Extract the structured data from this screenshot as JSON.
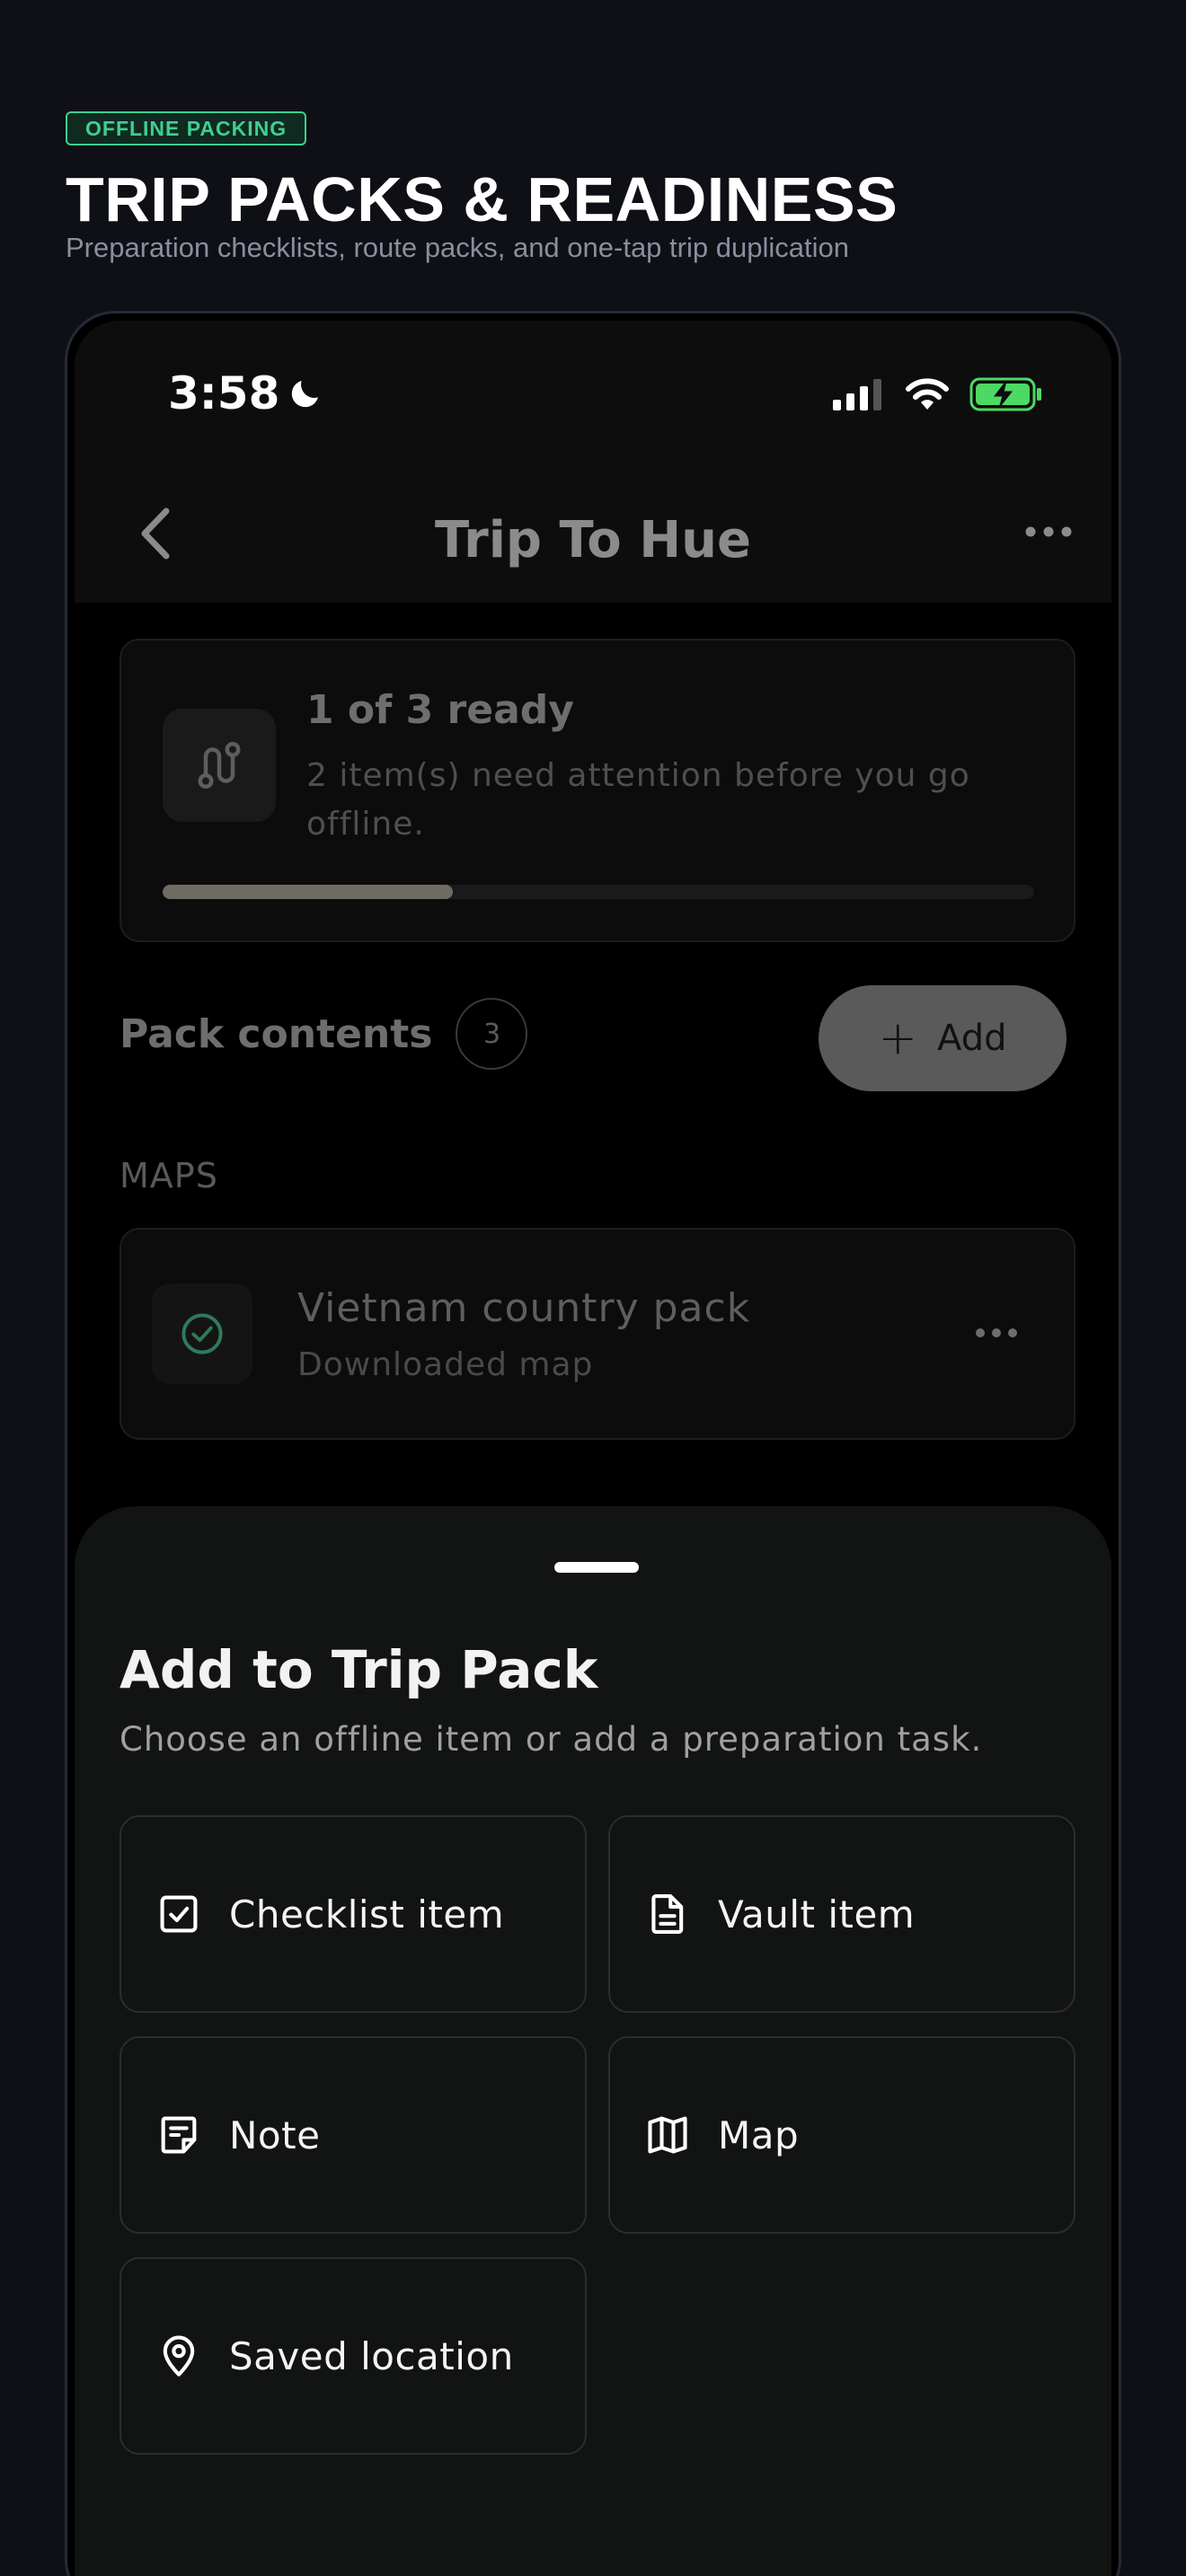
{
  "header": {
    "badge": "OFFLINE PACKING",
    "title": "TRIP PACKS & READINESS",
    "subtitle": "Preparation checklists, route packs, and one-tap trip duplication"
  },
  "status_bar": {
    "time": "3:58",
    "icons": [
      "moon-icon",
      "cellular-signal-icon",
      "wifi-icon",
      "battery-charging-icon"
    ],
    "battery_color": "#4cd964"
  },
  "nav": {
    "title": "Trip To Hue",
    "back_icon": "chevron-left-icon",
    "menu_icon": "more-horizontal-icon"
  },
  "readiness": {
    "title": "1 of 3 ready",
    "description": "2 item(s) need attention before you go offline.",
    "progress": 0.333,
    "icon": "route-icon"
  },
  "pack": {
    "label": "Pack contents",
    "count": "3",
    "add_label": "Add"
  },
  "sections": [
    {
      "label": "MAPS",
      "items": [
        {
          "name": "Vietnam country pack",
          "subtitle": "Downloaded map",
          "icon": "check-circle-icon"
        }
      ]
    }
  ],
  "sheet": {
    "title": "Add to Trip Pack",
    "description": "Choose an offline item or add a preparation task.",
    "options": [
      {
        "label": "Checklist item",
        "icon": "checkbox-icon"
      },
      {
        "label": "Vault item",
        "icon": "document-icon"
      },
      {
        "label": "Note",
        "icon": "note-icon"
      },
      {
        "label": "Map",
        "icon": "map-icon"
      },
      {
        "label": "Saved location",
        "icon": "location-pin-icon"
      }
    ]
  },
  "colors": {
    "accent": "#3ecf8e",
    "background": "#0e1015",
    "sheet": "#121313"
  }
}
